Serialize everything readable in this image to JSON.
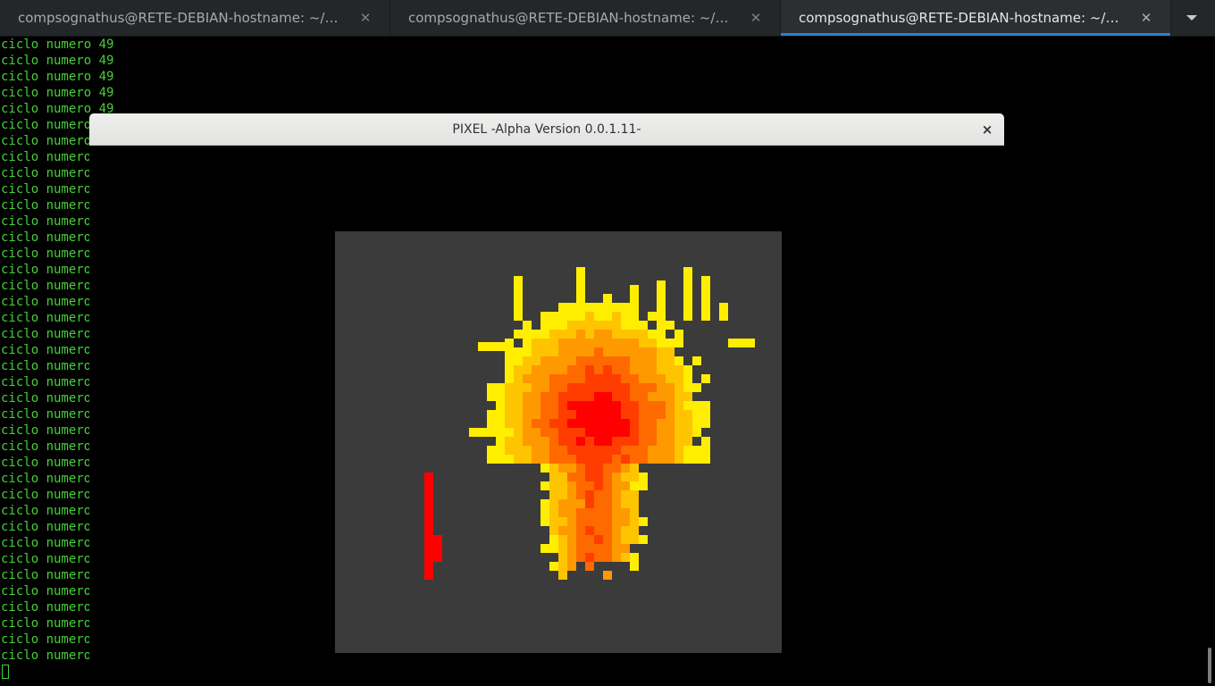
{
  "tabs": [
    {
      "title": "compsognathus@RETE-DEBIAN-hostname: ~/Documents/",
      "active": false
    },
    {
      "title": "compsognathus@RETE-DEBIAN-hostname: ~/Documents/",
      "active": false
    },
    {
      "title": "compsognathus@RETE-DEBIAN-hostname: ~/Documents/",
      "active": true
    }
  ],
  "terminal": {
    "line_text": "ciclo numero 49",
    "line_count": 39,
    "text_color": "#44d137"
  },
  "pixel_window": {
    "title": "PIXEL -Alpha Version 0.0.1.11-",
    "close_glyph": "×",
    "canvas_background": "#3b3b3b",
    "palette": {
      "yellow": "#ffee00",
      "amber": "#ffc400",
      "orange": "#ff9900",
      "dark_orange": "#ff6a00",
      "red_orange": "#ff3d00",
      "red": "#ff0000"
    }
  }
}
